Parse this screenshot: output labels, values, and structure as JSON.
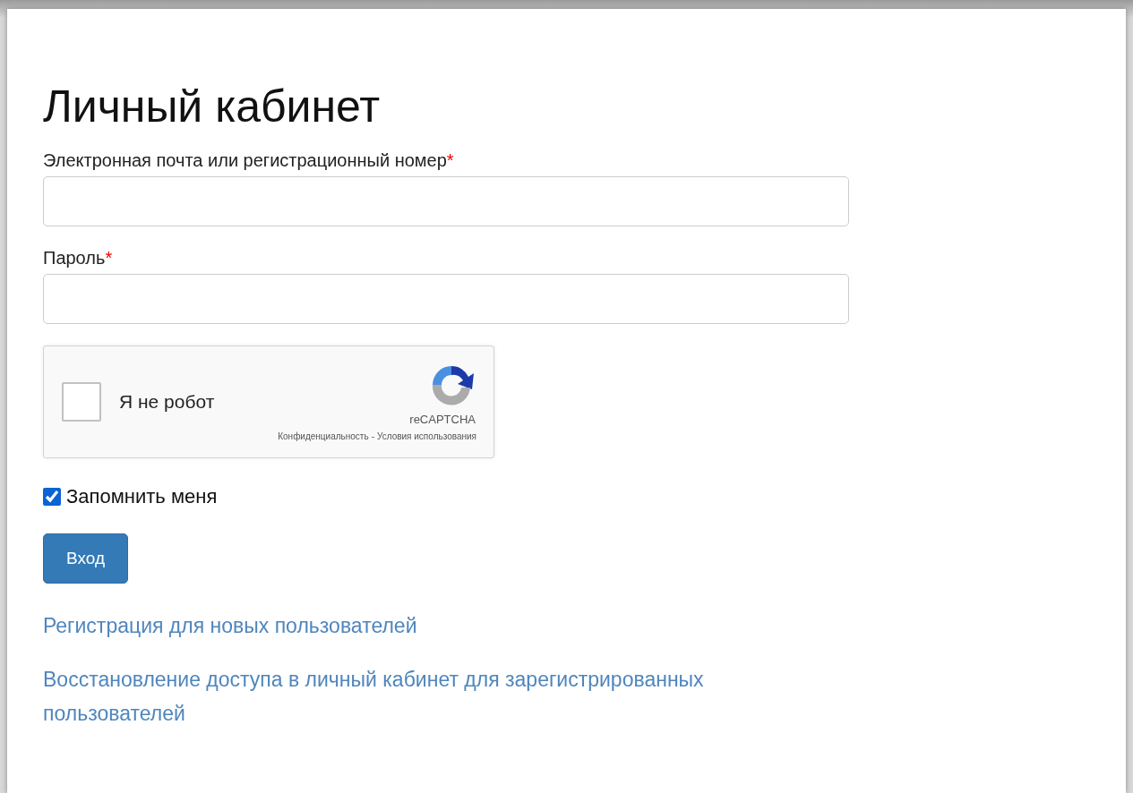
{
  "title": "Личный кабинет",
  "fields": [
    {
      "label": "Электронная почта или регистрационный номер",
      "required_mark": "*"
    },
    {
      "label": "Пароль",
      "required_mark": "*"
    }
  ],
  "captcha": {
    "label": "Я не робот",
    "checked": false,
    "brand": "reCAPTCHA",
    "privacy": "Конфиденциальность",
    "separator": "-",
    "terms": "Условия использования"
  },
  "remember": {
    "label": "Запомнить меня",
    "checked": true
  },
  "submit": "Вход",
  "links": [
    "Регистрация для новых пользователей",
    "Восстановление доступа в личный кабинет для зарегистрированных пользователей"
  ]
}
